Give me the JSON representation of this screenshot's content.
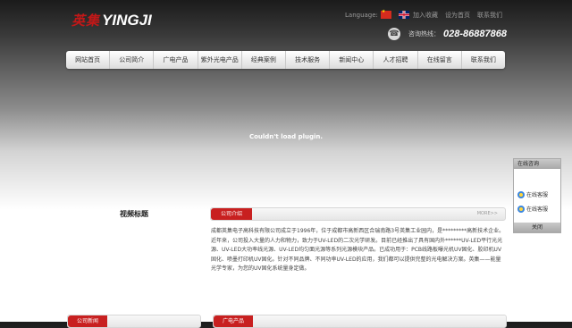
{
  "logo": {
    "cn": "英集",
    "en": "YINGJI"
  },
  "header": {
    "language_label": "Language:",
    "top_links": [
      "加入收藏",
      "设为首页",
      "联系我们"
    ],
    "hotline_label": "咨询热线：",
    "hotline_number": "028-86887868"
  },
  "nav": {
    "items": [
      "网站首页",
      "公司简介",
      "广电产品",
      "紫外光电产品",
      "经典案例",
      "技术服务",
      "新闻中心",
      "人才招聘",
      "在线留言",
      "联系我们"
    ]
  },
  "main": {
    "plugin_message": "Couldn't load plugin.",
    "video_title": "视频标题",
    "intro_tab": "公司介绍",
    "more_label": "MORE>>",
    "intro_text": "成都英集电子高科技有限公司成立于1996年，位于成都市高新西区合瑞南路3号英集工业园内，是*********高新技术企业。近年来，公司投入大量的人力和物力，致力于UV-LED的二次光学研发。目前已经推出了具有国内外******UV-LED平行光光源、UV-LED大功率线光源、UV-LED均匀面光源等系列光源模块产品。已成功用于：PCB线路板曝光机UV固化、胶印机UV固化、喷墨打印机UV固化。针对不同品牌、不同功率UV-LED的应用，我们都可以提供完整的光电解决方案。英集——能量光学专家，为您的UV固化系统量身定做。"
  },
  "bottom": {
    "left_tab": "公司新闻",
    "right_tab": "广电产品"
  },
  "side_panel": {
    "title": "在线咨询",
    "items": [
      "在线客服",
      "在线客服"
    ],
    "close_label": "关闭"
  },
  "colors": {
    "accent_red": "#c82020",
    "nav_bg": "#eeeeee"
  }
}
